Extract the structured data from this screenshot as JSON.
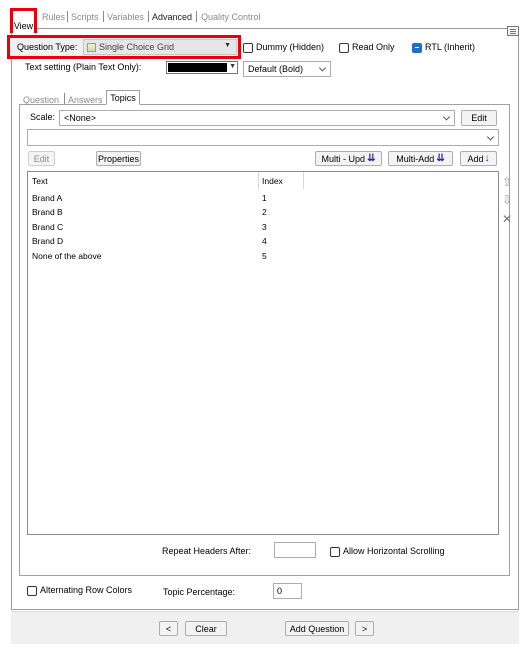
{
  "tabs": [
    "View",
    "Rules",
    "Scripts",
    "Variables",
    "Advanced",
    "Quality Control"
  ],
  "question_type": {
    "label": "Question Type:",
    "value": "Single Choice Grid"
  },
  "dummy": {
    "label": "Dummy (Hidden)",
    "checked": false
  },
  "read_only": {
    "label": "Read Only",
    "checked": false
  },
  "rtl": {
    "label": "RTL (Inherit)",
    "checked": true
  },
  "text_setting": {
    "label": "Text setting (Plain Text Only):",
    "color": "#000000",
    "font_value": "Default (Bold)"
  },
  "subtabs": [
    "Question",
    "Answers",
    "Topics"
  ],
  "scale": {
    "label": "Scale:",
    "value": "<None>",
    "edit_label": "Edit"
  },
  "toolbar": {
    "edit": "Edit",
    "properties": "Properties",
    "multi_update": "Multi - Upd",
    "multi_add": "Multi-Add",
    "add": "Add"
  },
  "grid": {
    "headers": [
      "Text",
      "Index"
    ],
    "rows": [
      {
        "text": "Brand A",
        "index": "1"
      },
      {
        "text": "Brand B",
        "index": "2"
      },
      {
        "text": "Brand C",
        "index": "3"
      },
      {
        "text": "Brand D",
        "index": "4"
      },
      {
        "text": "None of the above",
        "index": "5"
      }
    ]
  },
  "repeat_headers": {
    "label": "Repeat Headers After:",
    "value": ""
  },
  "horizontal_scrolling": {
    "label": "Allow Horizontal Scrolling",
    "checked": false
  },
  "alternating_rows": {
    "label": "Alternating Row Colors",
    "checked": false
  },
  "topic_percentage": {
    "label": "Topic Percentage:",
    "value": "0"
  },
  "footer": {
    "prev": "<",
    "clear": "Clear",
    "add_question": "Add Question",
    "next": ">"
  },
  "highlight_color": "#e8000b",
  "accent": "#1f6fc5",
  "arrow_color": "#2c2c9a"
}
